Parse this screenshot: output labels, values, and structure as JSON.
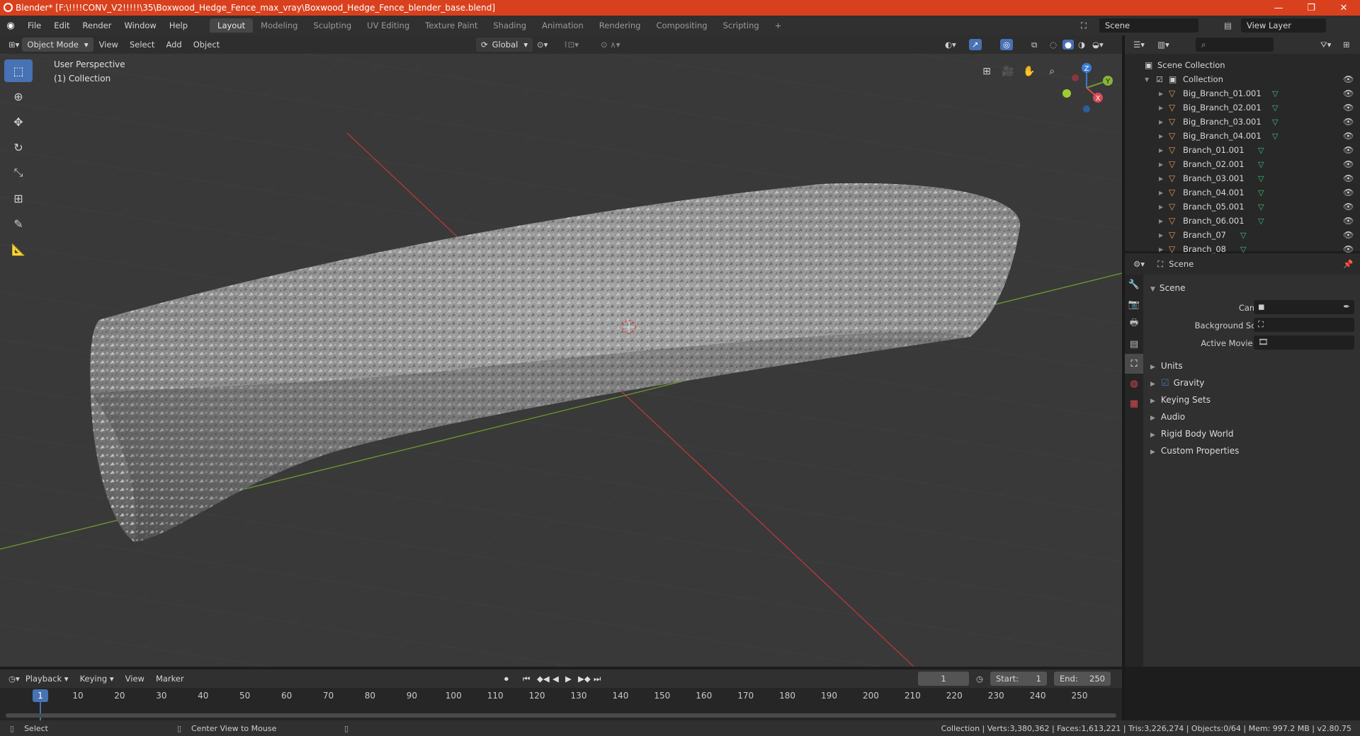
{
  "window": {
    "title": "Blender* [F:\\!!!!CONV_V2!!!!!\\35\\Boxwood_Hedge_Fence_max_vray\\Boxwood_Hedge_Fence_blender_base.blend]",
    "minimize": "—",
    "restore": "❐",
    "close": "✕"
  },
  "menus": [
    "File",
    "Edit",
    "Render",
    "Window",
    "Help"
  ],
  "workspaces": [
    "Layout",
    "Modeling",
    "Sculpting",
    "UV Editing",
    "Texture Paint",
    "Shading",
    "Animation",
    "Rendering",
    "Compositing",
    "Scripting"
  ],
  "active_workspace": "Layout",
  "scene_field": "Scene",
  "view_layer_field": "View Layer",
  "viewport_header": {
    "mode": "Object Mode",
    "menus": [
      "View",
      "Select",
      "Add",
      "Object"
    ],
    "transform_orientation": "Global"
  },
  "viewport": {
    "perspective_label": "User Perspective",
    "collection_label": "(1) Collection",
    "gizmo_axes": [
      "Z",
      "Y",
      "X"
    ]
  },
  "outliner": {
    "root": "Scene Collection",
    "collection": "Collection",
    "items": [
      "Big_Branch_01.001",
      "Big_Branch_02.001",
      "Big_Branch_03.001",
      "Big_Branch_04.001",
      "Branch_01.001",
      "Branch_02.001",
      "Branch_03.001",
      "Branch_04.001",
      "Branch_05.001",
      "Branch_06.001",
      "Branch_07",
      "Branch_08"
    ]
  },
  "properties": {
    "header": "Scene",
    "section": "Scene",
    "fields": [
      "Camera",
      "Background Scene",
      "Active Movie Clip"
    ],
    "panels": [
      "Units",
      "Gravity",
      "Keying Sets",
      "Audio",
      "Rigid Body World",
      "Custom Properties"
    ],
    "gravity_checked": true
  },
  "timeline": {
    "menus": [
      "Playback",
      "Keying",
      "View",
      "Marker"
    ],
    "current_frame": "1",
    "start_label": "Start:",
    "start": "1",
    "end_label": "End:",
    "end": "250",
    "frame_numbers": [
      "1",
      "10",
      "20",
      "30",
      "40",
      "50",
      "60",
      "70",
      "80",
      "90",
      "100",
      "110",
      "120",
      "130",
      "140",
      "150",
      "160",
      "170",
      "180",
      "190",
      "200",
      "210",
      "220",
      "230",
      "240",
      "250"
    ]
  },
  "statusbar": {
    "left": "Select",
    "middle": "Center View to Mouse",
    "right": "Collection | Verts:3,380,362 | Faces:1,613,221 | Tris:3,226,274 | Objects:0/64 | Mem: 997.2 MB | v2.80.75"
  },
  "colors": {
    "title_bar": "#d9411e",
    "accent_blue": "#4772b3",
    "axis_red": "#b8393d",
    "axis_green": "#6e9b2e",
    "object_orange": "#e89a4e",
    "mesh_green": "#3fc07a"
  }
}
